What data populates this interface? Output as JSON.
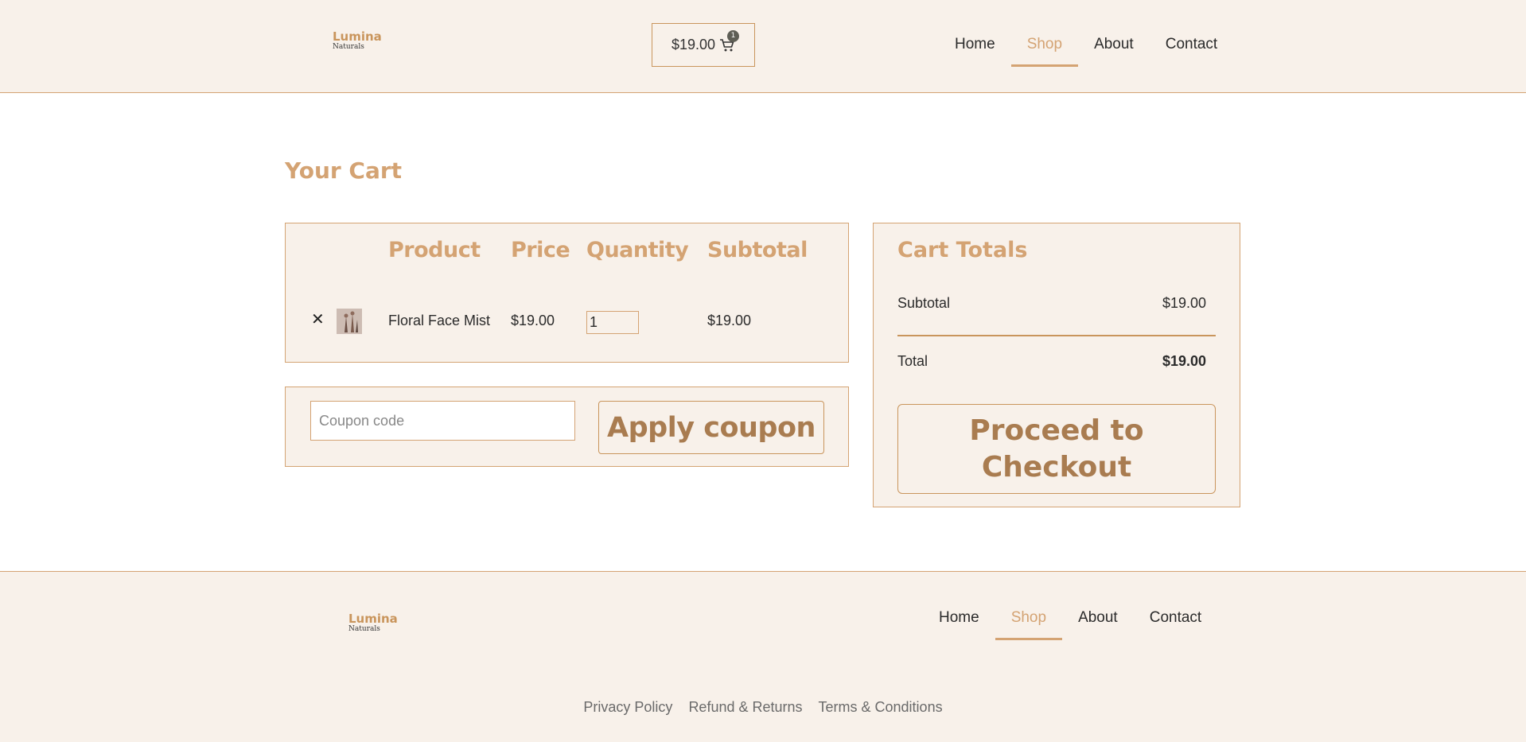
{
  "brand": {
    "name": "Lumina",
    "tagline": "Naturals"
  },
  "header": {
    "cart_total": "$19.00",
    "cart_count": "1",
    "nav": [
      "Home",
      "Shop",
      "About",
      "Contact"
    ],
    "active_nav": "Shop"
  },
  "page_title": "Your Cart",
  "table": {
    "headers": {
      "product": "Product",
      "price": "Price",
      "quantity": "Quantity",
      "subtotal": "Subtotal"
    },
    "rows": [
      {
        "remove_icon": "✕",
        "name": "Floral Face Mist",
        "price": "$19.00",
        "quantity": "1",
        "subtotal": "$19.00"
      }
    ]
  },
  "coupon": {
    "placeholder": "Coupon code",
    "button": "Apply coupon"
  },
  "totals": {
    "title": "Cart Totals",
    "subtotal_label": "Subtotal",
    "subtotal_value": "$19.00",
    "total_label": "Total",
    "total_value": "$19.00",
    "checkout_button": "Proceed to Checkout"
  },
  "footer": {
    "nav": [
      "Home",
      "Shop",
      "About",
      "Contact"
    ],
    "links": [
      "Privacy Policy",
      "Refund & Returns",
      "Terms & Conditions"
    ]
  },
  "colors": {
    "accent": "#d4a373",
    "button_text": "#a97c50",
    "panel_bg": "#f8f1ea"
  }
}
